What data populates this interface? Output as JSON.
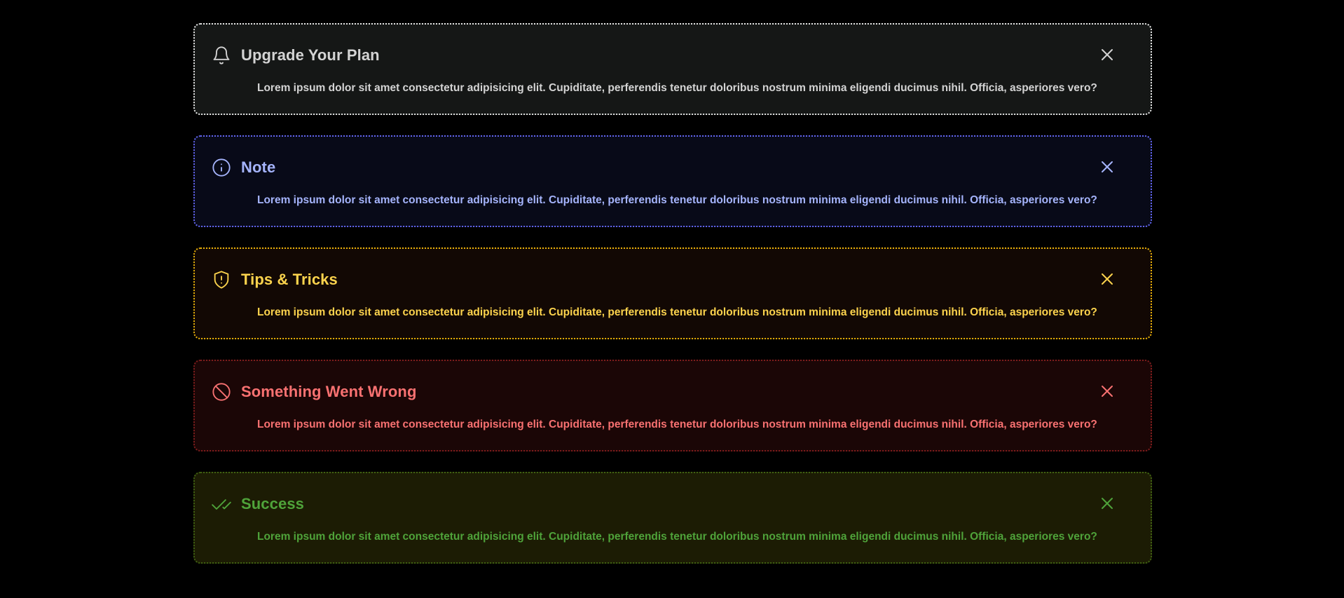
{
  "alerts": [
    {
      "variant": "neutral",
      "icon": "bell-icon",
      "title": "Upgrade Your Plan",
      "message": "Lorem ipsum dolor sit amet consectetur adipisicing elit. Cupiditate, perferendis tenetur doloribus nostrum minima eligendi ducimus nihil. Officia, asperiores vero?",
      "colors": {
        "text": "#d4d4d4",
        "border": "#e5e5e5",
        "background": "#151716"
      }
    },
    {
      "variant": "info",
      "icon": "info-icon",
      "title": "Note",
      "message": "Lorem ipsum dolor sit amet consectetur adipisicing elit. Cupiditate, perferendis tenetur doloribus nostrum minima eligendi ducimus nihil. Officia, asperiores vero?",
      "colors": {
        "text": "#a5b4fc",
        "border": "#6366f1",
        "background": "#080a18"
      }
    },
    {
      "variant": "warning",
      "icon": "shield-alert-icon",
      "title": "Tips & Tricks",
      "message": "Lorem ipsum dolor sit amet consectetur adipisicing elit. Cupiditate, perferendis tenetur doloribus nostrum minima eligendi ducimus nihil. Officia, asperiores vero?",
      "colors": {
        "text": "#fcd34d",
        "border": "#eab308",
        "background": "#120804"
      }
    },
    {
      "variant": "error",
      "icon": "ban-icon",
      "title": "Something Went Wrong",
      "message": "Lorem ipsum dolor sit amet consectetur adipisicing elit. Cupiditate, perferendis tenetur doloribus nostrum minima eligendi ducimus nihil. Officia, asperiores vero?",
      "colors": {
        "text": "#f87171",
        "border": "#7f1d1d",
        "background": "#1b0606"
      }
    },
    {
      "variant": "success",
      "icon": "check-check-icon",
      "title": "Success",
      "message": "Lorem ipsum dolor sit amet consectetur adipisicing elit. Cupiditate, perferendis tenetur doloribus nostrum minima eligendi ducimus nihil. Officia, asperiores vero?",
      "colors": {
        "text": "#4fa33a",
        "border": "#3f6212",
        "background": "#1c1c04"
      }
    }
  ],
  "close_icon": "close-icon"
}
